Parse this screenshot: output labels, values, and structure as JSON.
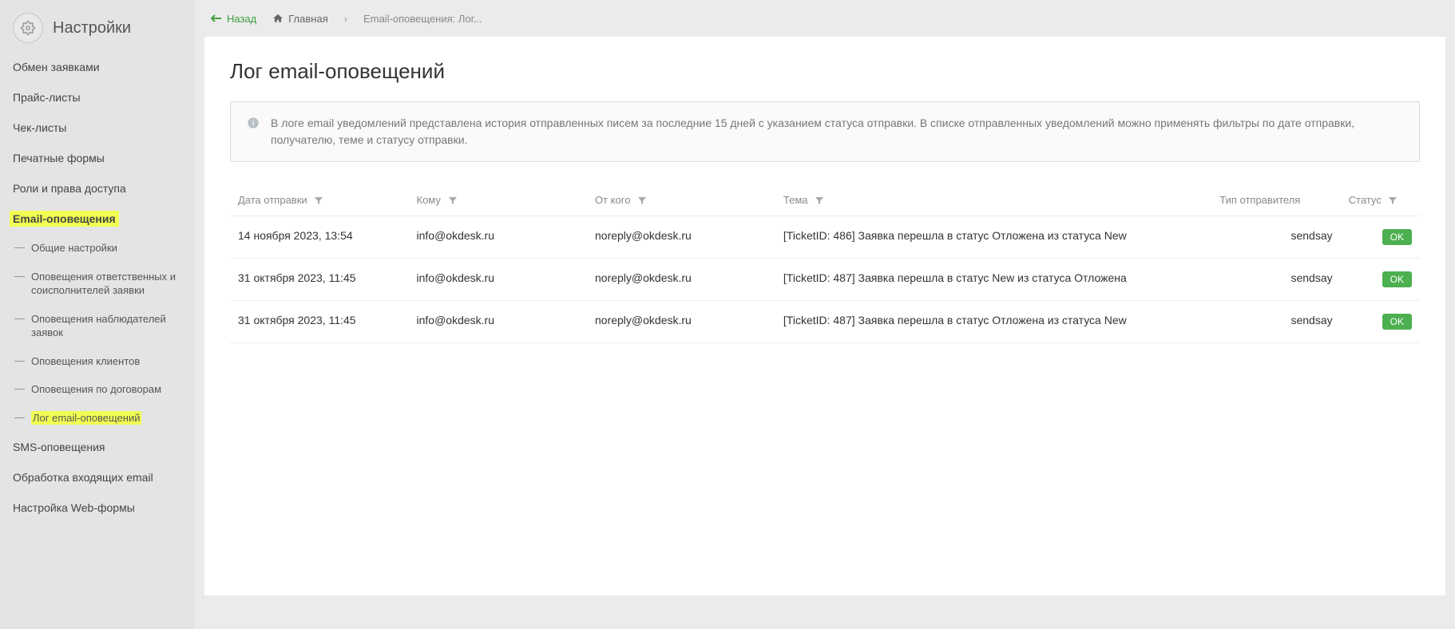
{
  "sidebar": {
    "title": "Настройки",
    "items": [
      {
        "label": "Обмен заявками",
        "type": "item"
      },
      {
        "label": "Прайс-листы",
        "type": "item"
      },
      {
        "label": "Чек-листы",
        "type": "item"
      },
      {
        "label": "Печатные формы",
        "type": "item"
      },
      {
        "label": "Роли и права доступа",
        "type": "item"
      },
      {
        "label": "Email-оповещения",
        "type": "highlight"
      },
      {
        "label": "Общие настройки",
        "type": "sub"
      },
      {
        "label": "Оповещения ответственных и соисполнителей заявки",
        "type": "sub"
      },
      {
        "label": "Оповещения наблюдателей заявок",
        "type": "sub"
      },
      {
        "label": "Оповещения клиентов",
        "type": "sub"
      },
      {
        "label": "Оповещения по договорам",
        "type": "sub"
      },
      {
        "label": "Лог email-оповещений",
        "type": "sub-highlight"
      },
      {
        "label": "SMS-оповещения",
        "type": "item"
      },
      {
        "label": "Обработка входящих email",
        "type": "item"
      },
      {
        "label": "Настройка Web-формы",
        "type": "item"
      }
    ]
  },
  "topbar": {
    "back": "Назад",
    "home": "Главная",
    "current": "Email-оповещения: Лог..."
  },
  "page": {
    "title": "Лог email-оповещений",
    "info": "В логе email уведомлений представлена история отправленных писем за последние 15 дней с указанием статуса отправки. В списке отправленных уведомлений можно применять фильтры по дате отправки, получателю, теме и статусу отправки."
  },
  "table": {
    "headers": {
      "date": "Дата отправки",
      "to": "Кому",
      "from": "От кого",
      "subject": "Тема",
      "sender": "Тип отправителя",
      "status": "Статус"
    },
    "rows": [
      {
        "date": "14 ноября 2023, 13:54",
        "to": "info@okdesk.ru",
        "from": "noreply@okdesk.ru",
        "subject": "[TicketID: 486] Заявка перешла в статус Отложена из статуса New",
        "sender": "sendsay",
        "status": "OK"
      },
      {
        "date": "31 октября 2023, 11:45",
        "to": "info@okdesk.ru",
        "from": "noreply@okdesk.ru",
        "subject": "[TicketID: 487] Заявка перешла в статус New из статуса Отложена",
        "sender": "sendsay",
        "status": "OK"
      },
      {
        "date": "31 октября 2023, 11:45",
        "to": "info@okdesk.ru",
        "from": "noreply@okdesk.ru",
        "subject": "[TicketID: 487] Заявка перешла в статус Отложена из статуса New",
        "sender": "sendsay",
        "status": "OK"
      }
    ]
  }
}
